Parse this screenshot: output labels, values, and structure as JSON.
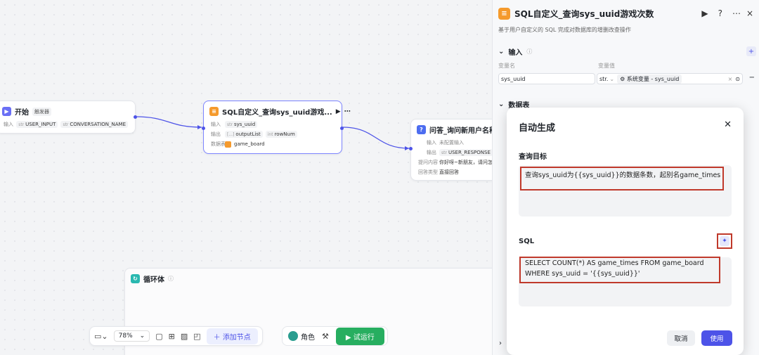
{
  "canvas": {
    "start_node": {
      "title": "开始",
      "badge": "触发器",
      "input_label": "输入",
      "vars": [
        {
          "type": "str",
          "name": "USER_INPUT"
        },
        {
          "type": "str",
          "name": "CONVERSATION_NAME"
        }
      ]
    },
    "sql_node": {
      "title": "SQL自定义_查询sys_uuid游戏...",
      "input_label": "输入",
      "input_var": {
        "type": "str",
        "name": "sys_uuid"
      },
      "output_label": "输出",
      "outputs": [
        {
          "type": "[...]",
          "name": "outputList"
        },
        {
          "type": "int",
          "name": "rowNum"
        }
      ],
      "table_label": "数据表",
      "table": "game_board"
    },
    "qa_node": {
      "title": "问答_询问新用户名称",
      "input_label": "输入",
      "input_value": "未配置输入",
      "output_label": "输出",
      "output_var": {
        "type": "str",
        "name": "USER_RESPONSE"
      },
      "question_label": "提问内容",
      "question_value": "你好呀~新朋友，请问怎",
      "answer_type_label": "回答类型",
      "answer_type_value": "直接回答"
    },
    "loop_node": {
      "title": "循环体"
    }
  },
  "toolbar": {
    "zoom": "78%",
    "add_node": "添加节点",
    "role": "角色",
    "run": "试运行"
  },
  "panel": {
    "title": "SQL自定义_查询sys_uuid游戏次数",
    "subtitle": "基于用户自定义的 SQL 完成对数据库的增删改查操作",
    "input_section": "输入",
    "col_var_name": "变量名",
    "col_var_value": "变量值",
    "var_name": "sys_uuid",
    "var_type": "str.",
    "var_value": "系统变量 - sys_uuid",
    "table_section": "数据表"
  },
  "modal": {
    "title": "自动生成",
    "query_label": "查询目标",
    "query_text": "查询sys_uuid为{{sys_uuid}}的数据条数，起别名game_times",
    "sql_label": "SQL",
    "sql_line1": "SELECT COUNT(*) AS game_times FROM game_board",
    "sql_line2": "WHERE sys_uuid = '{{sys_uuid}}'",
    "cancel": "取消",
    "use": "使用"
  },
  "colors": {
    "accent": "#4d53e8",
    "run_green": "#27ae60",
    "sql_orange": "#f59a2c",
    "highlight_red": "#c0392b"
  }
}
